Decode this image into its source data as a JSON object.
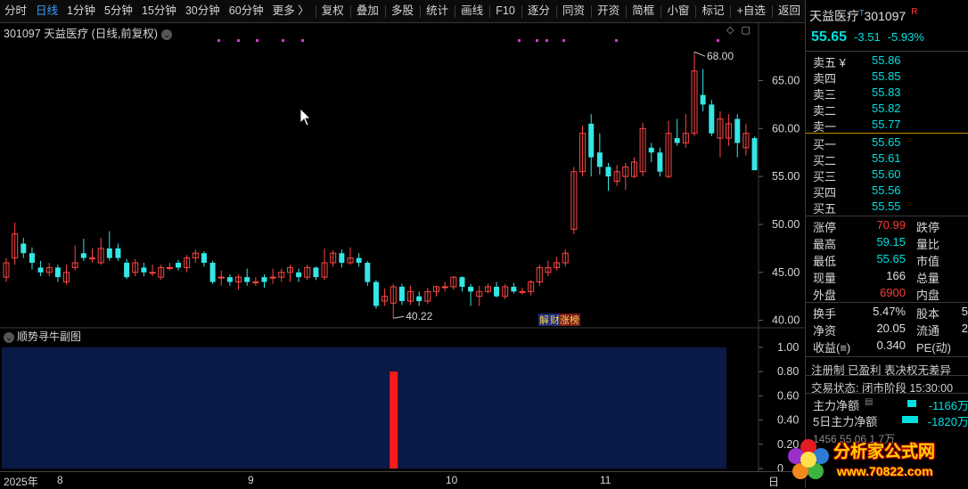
{
  "toolbar": {
    "items": [
      "分时",
      "日线",
      "1分钟",
      "5分钟",
      "15分钟",
      "30分钟",
      "60分钟",
      "更多 〉",
      "复权",
      "叠加",
      "多股",
      "统计",
      "画线",
      "F10",
      "逐分",
      "同资",
      "开资",
      "简框",
      "小窗",
      "标记",
      "+自选",
      "返回"
    ],
    "active": "日线"
  },
  "chart": {
    "title": "301097 天益医疗 (日线,前复权)",
    "y_ticks": [
      "65.00",
      "60.00",
      "55.00",
      "50.00",
      "45.00",
      "40.00"
    ],
    "high_label": "68.00",
    "low_label": "40.22",
    "tags": [
      "解",
      "财",
      "涨榜"
    ],
    "sub_title": "顺势寻牛副图",
    "sub_y_ticks": [
      "1.00",
      "0.80",
      "0.60",
      "0.40",
      "0.20",
      "0"
    ],
    "x_labels": [
      "2025年",
      "8",
      "9",
      "10",
      "11",
      "日"
    ]
  },
  "chart_data": {
    "type": "candlestick",
    "title": "301097 天益医疗 (日线,前复权)",
    "ylim": [
      39.5,
      69.5
    ],
    "y_ticks": [
      40,
      45,
      50,
      55,
      60,
      65
    ],
    "x_labels": [
      "2025年",
      "8",
      "9",
      "10",
      "11"
    ],
    "candles": [
      {
        "o": 44.5,
        "c": 46.0,
        "h": 46.5,
        "l": 44.0
      },
      {
        "o": 46.5,
        "c": 49.0,
        "h": 50.2,
        "l": 45.8
      },
      {
        "o": 48.0,
        "c": 47.0,
        "h": 48.6,
        "l": 46.5
      },
      {
        "o": 47.0,
        "c": 46.0,
        "h": 47.6,
        "l": 45.3
      },
      {
        "o": 45.5,
        "c": 45.0,
        "h": 46.2,
        "l": 44.6
      },
      {
        "o": 45.0,
        "c": 45.5,
        "h": 46.0,
        "l": 44.6
      },
      {
        "o": 45.5,
        "c": 44.5,
        "h": 45.8,
        "l": 44.0
      },
      {
        "o": 44.0,
        "c": 45.0,
        "h": 45.8,
        "l": 43.7
      },
      {
        "o": 45.5,
        "c": 46.0,
        "h": 47.8,
        "l": 45.2
      },
      {
        "o": 47.0,
        "c": 46.5,
        "h": 48.5,
        "l": 46.2
      },
      {
        "o": 46.5,
        "c": 46.5,
        "h": 47.5,
        "l": 46.0
      },
      {
        "o": 46.0,
        "c": 47.5,
        "h": 48.6,
        "l": 45.8
      },
      {
        "o": 47.5,
        "c": 46.5,
        "h": 49.3,
        "l": 46.2
      },
      {
        "o": 47.5,
        "c": 46.5,
        "h": 48.0,
        "l": 46.2
      },
      {
        "o": 46.0,
        "c": 44.5,
        "h": 46.4,
        "l": 44.3
      },
      {
        "o": 45.0,
        "c": 46.0,
        "h": 46.4,
        "l": 44.6
      },
      {
        "o": 45.5,
        "c": 45.0,
        "h": 46.0,
        "l": 44.6
      },
      {
        "o": 45.0,
        "c": 45.0,
        "h": 45.8,
        "l": 44.6
      },
      {
        "o": 44.5,
        "c": 45.5,
        "h": 45.8,
        "l": 44.2
      },
      {
        "o": 45.5,
        "c": 45.5,
        "h": 46.0,
        "l": 45.2
      },
      {
        "o": 46.0,
        "c": 45.5,
        "h": 46.3,
        "l": 45.2
      },
      {
        "o": 45.5,
        "c": 46.5,
        "h": 46.8,
        "l": 45.0
      },
      {
        "o": 46.5,
        "c": 47.0,
        "h": 47.4,
        "l": 46.0
      },
      {
        "o": 47.0,
        "c": 46.0,
        "h": 47.2,
        "l": 45.6
      },
      {
        "o": 46.0,
        "c": 44.0,
        "h": 46.2,
        "l": 43.8
      },
      {
        "o": 44.5,
        "c": 44.5,
        "h": 45.2,
        "l": 43.6
      },
      {
        "o": 44.5,
        "c": 44.0,
        "h": 44.8,
        "l": 43.6
      },
      {
        "o": 44.0,
        "c": 44.5,
        "h": 44.8,
        "l": 43.2
      },
      {
        "o": 44.5,
        "c": 44.0,
        "h": 45.4,
        "l": 43.6
      },
      {
        "o": 44.0,
        "c": 44.0,
        "h": 44.5,
        "l": 43.6
      },
      {
        "o": 44.5,
        "c": 44.0,
        "h": 44.8,
        "l": 43.4
      },
      {
        "o": 44.5,
        "c": 44.5,
        "h": 45.4,
        "l": 43.8
      },
      {
        "o": 44.5,
        "c": 45.0,
        "h": 45.4,
        "l": 44.0
      },
      {
        "o": 45.0,
        "c": 45.5,
        "h": 45.8,
        "l": 44.0
      },
      {
        "o": 45.0,
        "c": 44.5,
        "h": 45.4,
        "l": 44.0
      },
      {
        "o": 44.5,
        "c": 45.5,
        "h": 45.8,
        "l": 44.2
      },
      {
        "o": 45.5,
        "c": 44.5,
        "h": 45.6,
        "l": 44.2
      },
      {
        "o": 44.5,
        "c": 46.0,
        "h": 47.5,
        "l": 44.2
      },
      {
        "o": 46.0,
        "c": 47.0,
        "h": 47.3,
        "l": 45.6
      },
      {
        "o": 47.0,
        "c": 46.0,
        "h": 47.4,
        "l": 45.5
      },
      {
        "o": 46.0,
        "c": 46.5,
        "h": 47.6,
        "l": 45.8
      },
      {
        "o": 46.5,
        "c": 46.0,
        "h": 47.0,
        "l": 45.6
      },
      {
        "o": 46.0,
        "c": 44.0,
        "h": 46.2,
        "l": 43.6
      },
      {
        "o": 44.0,
        "c": 41.5,
        "h": 44.2,
        "l": 41.2
      },
      {
        "o": 42.0,
        "c": 42.5,
        "h": 43.3,
        "l": 41.5
      },
      {
        "o": 41.8,
        "c": 43.5,
        "h": 43.8,
        "l": 40.22
      },
      {
        "o": 43.5,
        "c": 42.0,
        "h": 43.8,
        "l": 41.6
      },
      {
        "o": 42.0,
        "c": 43.0,
        "h": 43.6,
        "l": 41.6
      },
      {
        "o": 42.5,
        "c": 42.0,
        "h": 43.0,
        "l": 41.5
      },
      {
        "o": 42.0,
        "c": 43.0,
        "h": 43.4,
        "l": 41.7
      },
      {
        "o": 43.0,
        "c": 43.5,
        "h": 43.6,
        "l": 42.5
      },
      {
        "o": 43.5,
        "c": 43.5,
        "h": 44.0,
        "l": 43.0
      },
      {
        "o": 43.5,
        "c": 44.5,
        "h": 44.6,
        "l": 43.2
      },
      {
        "o": 44.5,
        "c": 43.5,
        "h": 44.6,
        "l": 43.0
      },
      {
        "o": 43.5,
        "c": 43.0,
        "h": 43.8,
        "l": 41.5
      },
      {
        "o": 42.5,
        "c": 43.0,
        "h": 43.6,
        "l": 41.5
      },
      {
        "o": 43.0,
        "c": 43.5,
        "h": 43.8,
        "l": 42.8
      },
      {
        "o": 43.5,
        "c": 42.5,
        "h": 44.0,
        "l": 42.4
      },
      {
        "o": 42.5,
        "c": 43.5,
        "h": 43.8,
        "l": 42.2
      },
      {
        "o": 43.5,
        "c": 43.0,
        "h": 43.9,
        "l": 42.8
      },
      {
        "o": 43.0,
        "c": 43.0,
        "h": 43.4,
        "l": 42.7
      },
      {
        "o": 43.0,
        "c": 44.0,
        "h": 44.2,
        "l": 42.6
      },
      {
        "o": 44.0,
        "c": 45.5,
        "h": 45.8,
        "l": 43.6
      },
      {
        "o": 45.0,
        "c": 45.5,
        "h": 46.2,
        "l": 44.6
      },
      {
        "o": 45.5,
        "c": 46.0,
        "h": 46.6,
        "l": 45.2
      },
      {
        "o": 46.0,
        "c": 47.0,
        "h": 47.4,
        "l": 45.6
      },
      {
        "o": 49.5,
        "c": 55.5,
        "h": 56.0,
        "l": 49.0
      },
      {
        "o": 55.5,
        "c": 59.5,
        "h": 60.3,
        "l": 55.0
      },
      {
        "o": 60.5,
        "c": 57.0,
        "h": 61.5,
        "l": 55.0
      },
      {
        "o": 57.5,
        "c": 56.0,
        "h": 59.5,
        "l": 55.2
      },
      {
        "o": 56.0,
        "c": 55.0,
        "h": 56.4,
        "l": 53.5
      },
      {
        "o": 54.5,
        "c": 55.5,
        "h": 56.2,
        "l": 54.0
      },
      {
        "o": 55.0,
        "c": 56.0,
        "h": 56.4,
        "l": 53.6
      },
      {
        "o": 55.0,
        "c": 56.5,
        "h": 57.0,
        "l": 54.8
      },
      {
        "o": 55.5,
        "c": 60.0,
        "h": 60.6,
        "l": 55.0
      },
      {
        "o": 58.0,
        "c": 57.5,
        "h": 58.5,
        "l": 56.5
      },
      {
        "o": 57.5,
        "c": 55.5,
        "h": 58.0,
        "l": 55.0
      },
      {
        "o": 55.0,
        "c": 59.5,
        "h": 60.8,
        "l": 54.8
      },
      {
        "o": 59.0,
        "c": 58.5,
        "h": 61.0,
        "l": 58.2
      },
      {
        "o": 58.5,
        "c": 59.5,
        "h": 61.5,
        "l": 58.0
      },
      {
        "o": 59.5,
        "c": 66.0,
        "h": 68.0,
        "l": 59.2
      },
      {
        "o": 63.5,
        "c": 62.5,
        "h": 66.2,
        "l": 61.8
      },
      {
        "o": 62.5,
        "c": 59.5,
        "h": 63.0,
        "l": 59.2
      },
      {
        "o": 59.0,
        "c": 61.0,
        "h": 61.8,
        "l": 57.0
      },
      {
        "o": 59.0,
        "c": 60.5,
        "h": 61.5,
        "l": 58.2
      },
      {
        "o": 61.0,
        "c": 58.5,
        "h": 61.5,
        "l": 57.0
      },
      {
        "o": 58.0,
        "c": 59.5,
        "h": 60.5,
        "l": 57.2
      },
      {
        "o": 59.0,
        "c": 55.65,
        "h": 59.15,
        "l": 55.65
      }
    ],
    "sub_chart": {
      "type": "bar",
      "title": "顺势寻牛副图",
      "ylim": [
        0,
        1
      ],
      "y_ticks": [
        0,
        0.2,
        0.4,
        0.6,
        0.8,
        1.0
      ],
      "signal_index": 45,
      "signal_value": 0.8
    }
  },
  "side": {
    "name": "天益医疗",
    "name_sup": "T",
    "code": "301097",
    "r_badge": "R",
    "price": "55.65",
    "change": "-3.51",
    "change_pct": "-5.93%",
    "asks": [
      {
        "label": "卖五 ¥",
        "value": "55.86"
      },
      {
        "label": "卖四",
        "value": "55.85"
      },
      {
        "label": "卖三",
        "value": "55.83"
      },
      {
        "label": "卖二",
        "value": "55.82"
      },
      {
        "label": "卖一",
        "value": "55.77"
      }
    ],
    "bids": [
      {
        "label": "买一",
        "value": "55.65"
      },
      {
        "label": "买二",
        "value": "55.61"
      },
      {
        "label": "买三",
        "value": "55.60"
      },
      {
        "label": "买四",
        "value": "55.56"
      },
      {
        "label": "买五",
        "value": "55.55"
      }
    ],
    "stats_left": [
      {
        "label": "涨停",
        "value": "70.99",
        "color": "red"
      },
      {
        "label": "最高",
        "value": "59.15",
        "color": "cyan"
      },
      {
        "label": "最低",
        "value": "55.65",
        "color": "cyan"
      },
      {
        "label": "现量",
        "value": "166",
        "color": "white"
      },
      {
        "label": "外盘",
        "value": "6900",
        "color": "red"
      }
    ],
    "stats_right": [
      "跌停",
      "量比",
      "市值",
      "总量",
      "内盘"
    ],
    "stats2_left": [
      {
        "label": "换手",
        "value": "5.47%"
      },
      {
        "label": "净资",
        "value": "20.05"
      },
      {
        "label": "收益(≡)",
        "value": "0.340"
      }
    ],
    "stats2_right": [
      "股本",
      "流通",
      "PE(动)"
    ],
    "stats2_right_vals": [
      "5",
      "2",
      ""
    ],
    "tags_line": "注册制 已盈利 表决权无差异",
    "trade_status": "交易状态: 闭市阶段 15:30:00",
    "flow": [
      {
        "label": "主力净额",
        "value": "-1166万"
      },
      {
        "label": "5日主力净额",
        "value": "-1820万"
      }
    ],
    "bottom_row": "1456   55.06   1.7万"
  },
  "watermark": {
    "line1": "分析家公式网",
    "line2": "www.70822.com"
  }
}
